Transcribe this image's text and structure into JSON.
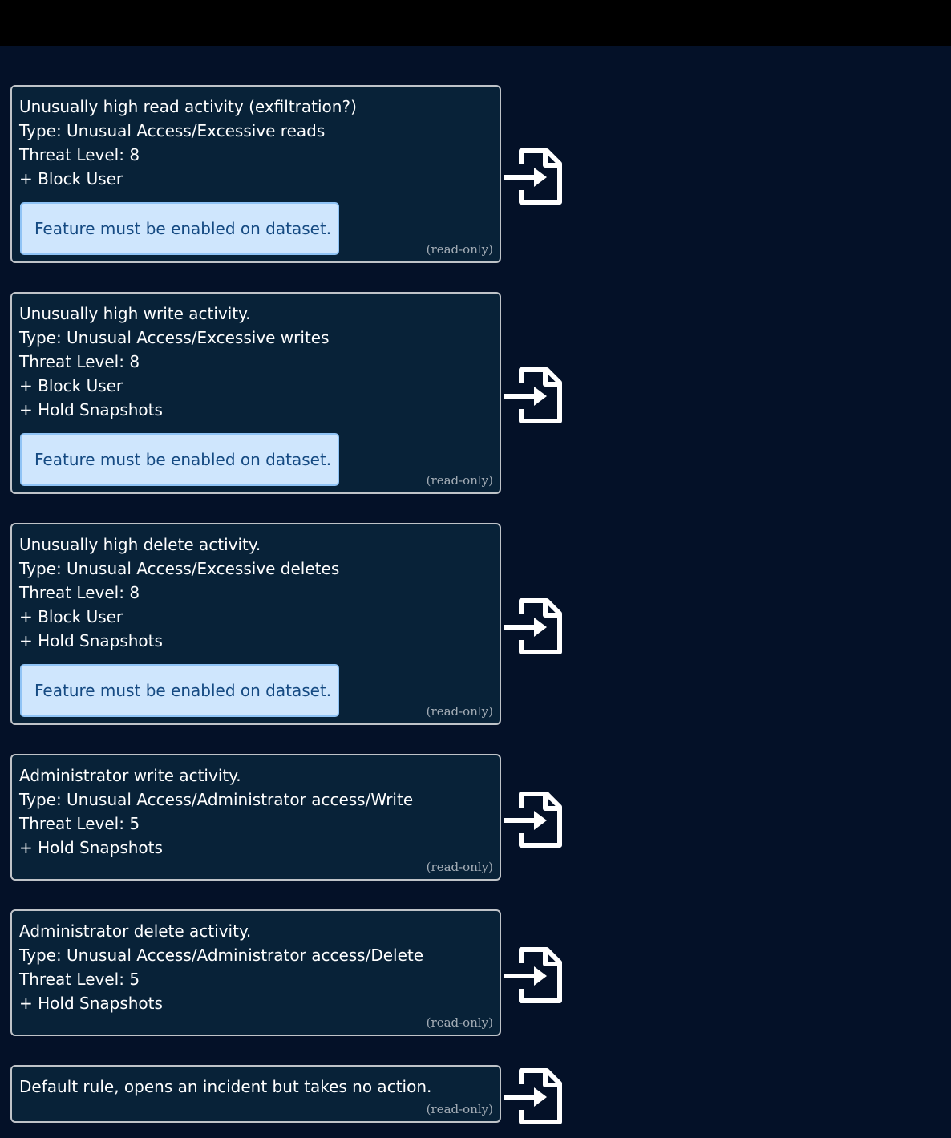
{
  "rules": [
    {
      "lines": [
        "Unusually high read activity (exfiltration?)",
        "Type: Unusual Access/Excessive reads",
        "Threat Level: 8",
        "+ Block User"
      ],
      "notice": "Feature must be enabled on dataset.",
      "readonly": "(read-only)",
      "icon": "open-rule-icon"
    },
    {
      "lines": [
        "Unusually high write activity.",
        "Type: Unusual Access/Excessive writes",
        "Threat Level: 8",
        "+ Block User",
        "+ Hold Snapshots"
      ],
      "notice": "Feature must be enabled on dataset.",
      "readonly": "(read-only)",
      "icon": "open-rule-icon"
    },
    {
      "lines": [
        "Unusually high delete activity.",
        "Type: Unusual Access/Excessive deletes",
        "Threat Level: 8",
        "+ Block User",
        "+ Hold Snapshots"
      ],
      "notice": "Feature must be enabled on dataset.",
      "readonly": "(read-only)",
      "icon": "open-rule-icon"
    },
    {
      "lines": [
        "Administrator write activity.",
        "Type: Unusual Access/Administrator access/Write",
        "Threat Level: 5",
        "+ Hold Snapshots"
      ],
      "notice": null,
      "readonly": "(read-only)",
      "icon": "open-rule-icon"
    },
    {
      "lines": [
        "Administrator delete activity.",
        "Type: Unusual Access/Administrator access/Delete",
        "Threat Level: 5",
        "+ Hold Snapshots"
      ],
      "notice": null,
      "readonly": "(read-only)",
      "icon": "open-rule-icon"
    },
    {
      "lines": [
        "Default rule, opens an incident but takes no action."
      ],
      "notice": null,
      "readonly": "(read-only)",
      "icon": "open-rule-icon"
    }
  ],
  "colors": {
    "page_background": "#041128",
    "card_background": "#082238",
    "card_border": "#bfc3c8",
    "notice_background": "#cfe6fd",
    "notice_text": "#154a82",
    "readonly_text": "#a4adb6"
  }
}
